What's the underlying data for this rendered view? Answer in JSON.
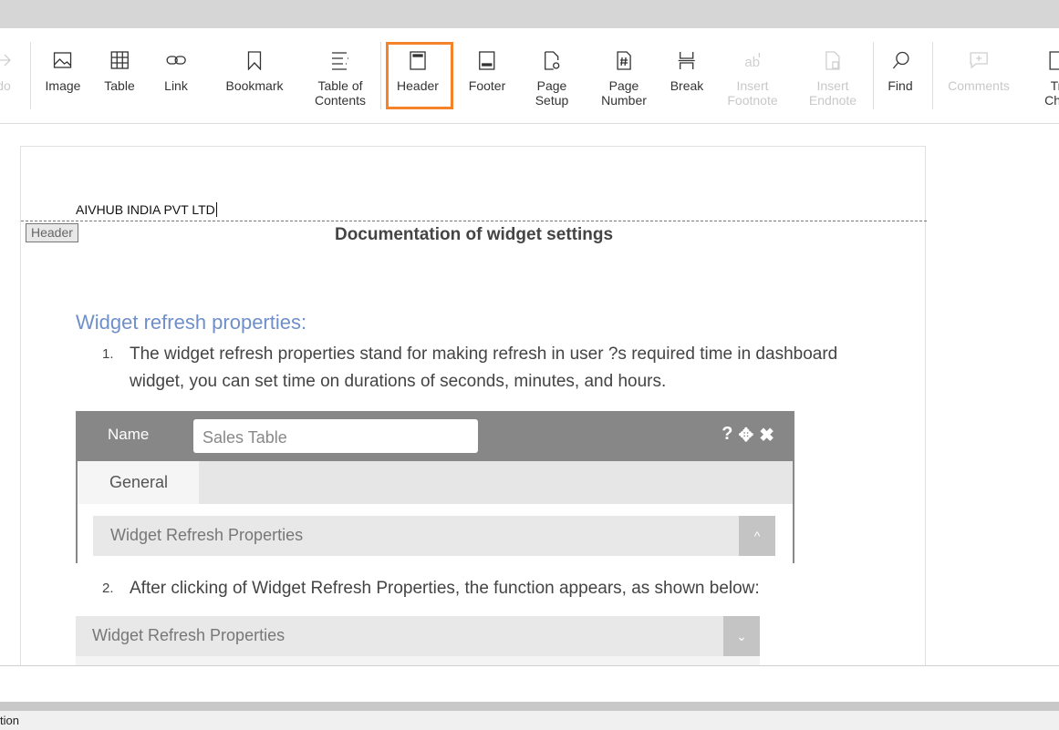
{
  "toolbar": {
    "undo_label": "do",
    "items": [
      {
        "label": "Image",
        "icon": "image-icon"
      },
      {
        "label": "Table",
        "icon": "table-icon"
      },
      {
        "label": "Link",
        "icon": "link-icon"
      },
      {
        "label": "Bookmark",
        "icon": "bookmark-icon"
      },
      {
        "label": "Table of\nContents",
        "icon": "table-of-contents-icon"
      },
      {
        "label": "Header",
        "icon": "header-icon"
      },
      {
        "label": "Footer",
        "icon": "footer-icon"
      },
      {
        "label": "Page\nSetup",
        "icon": "page-setup-icon"
      },
      {
        "label": "Page\nNumber",
        "icon": "page-number-icon"
      },
      {
        "label": "Break",
        "icon": "break-icon"
      },
      {
        "label": "Insert\nFootnote",
        "icon": "footnote-icon"
      },
      {
        "label": "Insert\nEndnote",
        "icon": "endnote-icon"
      },
      {
        "label": "Find",
        "icon": "search-icon"
      },
      {
        "label": "Comments",
        "icon": "comment-icon"
      },
      {
        "label": "Tr\nCha",
        "icon": "track-changes-icon"
      }
    ],
    "highlight_color": "#f5832a"
  },
  "document": {
    "header_text": "AIVHUB INDIA PVT LTD",
    "header_tag": "Header",
    "title": "Documentation of widget settings",
    "heading": "Widget refresh properties:",
    "heading_color": "#6f8fc9",
    "list": [
      {
        "num": "1.",
        "text": "The widget refresh properties stand for making refresh in user ?s required time in dashboard widget, you can set time on durations of seconds, minutes, and hours."
      },
      {
        "num": "2.",
        "text": "After clicking of Widget Refresh Properties, the function appears, as shown below:"
      }
    ],
    "shot1": {
      "name_label": "Name",
      "name_value": "Sales Table",
      "tab": "General",
      "accordion": "Widget Refresh Properties"
    },
    "shot2": {
      "accordion": "Widget Refresh Properties"
    }
  },
  "status": {
    "text": "tion"
  }
}
